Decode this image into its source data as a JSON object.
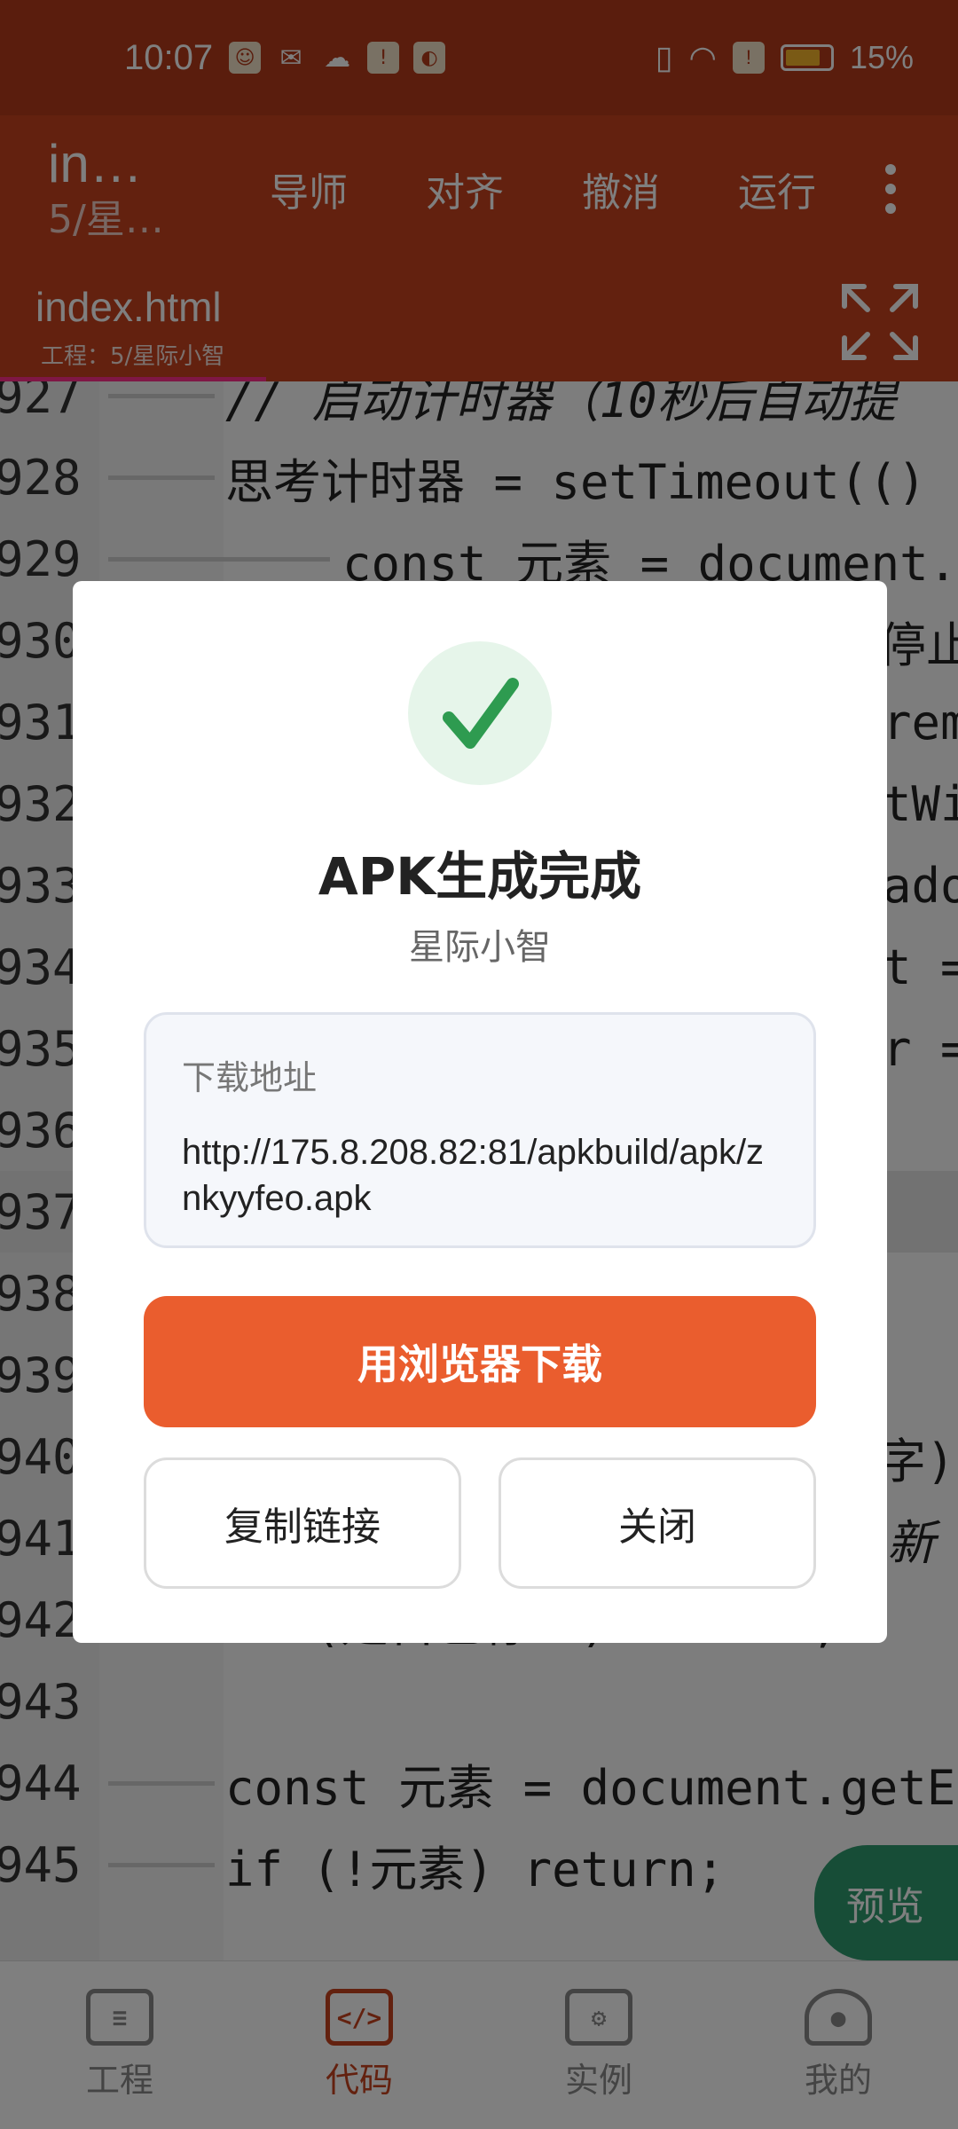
{
  "status_bar": {
    "time": "10:07",
    "battery": "15%",
    "notification_icons": [
      "app-icon",
      "wechat-icon",
      "cloud-icon",
      "alert-icon",
      "photos-icon"
    ]
  },
  "toolbar": {
    "title": "in…",
    "subtitle": "5/星…",
    "actions": [
      "导师",
      "对齐",
      "撤消",
      "运行"
    ]
  },
  "tab": {
    "file_name": "index.html",
    "project_label": "工程：5/星际小智"
  },
  "editor": {
    "lines": [
      {
        "num": "927",
        "text": "// 启动计时器（10秒后自动提"
      },
      {
        "num": "928",
        "text": "思考计时器 = setTimeout(()"
      },
      {
        "num": "929",
        "text": "const 元素 = document."
      },
      {
        "num": "930",
        "text": "停止"
      },
      {
        "num": "931",
        "text": "rem"
      },
      {
        "num": "932",
        "text": "tWi"
      },
      {
        "num": "933",
        "text": "ado"
      },
      {
        "num": "934",
        "text": "t ="
      },
      {
        "num": "935",
        "text": "r ="
      },
      {
        "num": "936",
        "text": ""
      },
      {
        "num": "937",
        "text": ""
      },
      {
        "num": "938",
        "text": ""
      },
      {
        "num": "939",
        "text": ""
      },
      {
        "num": "940",
        "text": "字)"
      },
      {
        "num": "941",
        "text": "新"
      },
      {
        "num": "942",
        "text": "if (是否已停止) return;"
      },
      {
        "num": "943",
        "text": ""
      },
      {
        "num": "944",
        "text": "const 元素 = document.getE"
      },
      {
        "num": "945",
        "text": "if (!元素) return;"
      }
    ]
  },
  "preview_button": "预览",
  "bottom_nav": [
    {
      "label": "工程",
      "active": false
    },
    {
      "label": "代码",
      "active": true
    },
    {
      "label": "实例",
      "active": false
    },
    {
      "label": "我的",
      "active": false
    }
  ],
  "dialog": {
    "title": "APK生成完成",
    "subtitle": "星际小智",
    "url_label": "下载地址",
    "url": "http://175.8.208.82:81/apkbuild/apk/znkyyfeo.apk",
    "primary_button": "用浏览器下载",
    "copy_button": "复制链接",
    "close_button": "关闭"
  },
  "colors": {
    "brand": "#c7421e",
    "accent_button": "#ea5d2e",
    "success": "#2e9b50",
    "preview": "#2e9b6e"
  }
}
